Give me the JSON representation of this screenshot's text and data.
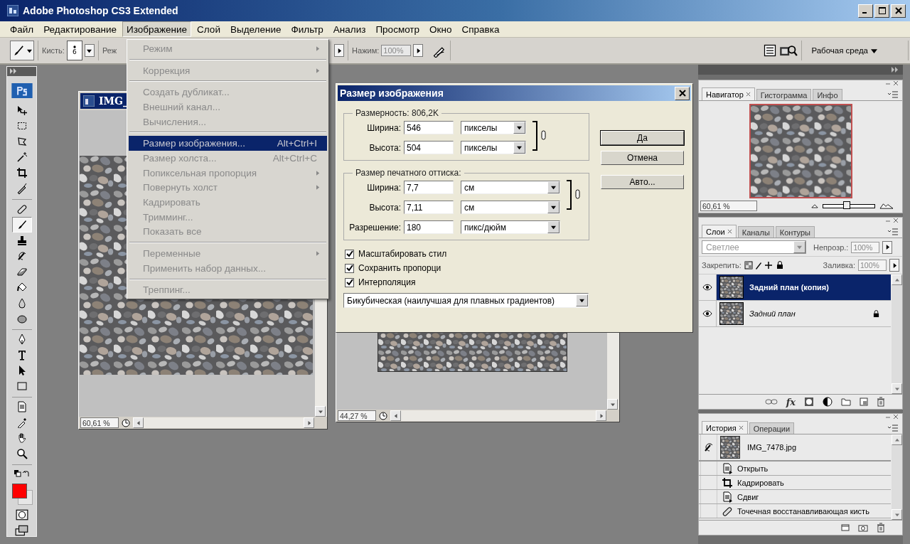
{
  "window": {
    "title": "Adobe Photoshop CS3 Extended"
  },
  "menu_bar": [
    {
      "label": "Файл",
      "selected": false
    },
    {
      "label": "Редактирование",
      "selected": false
    },
    {
      "label": "Изображение",
      "selected": true
    },
    {
      "label": "Слой",
      "selected": false
    },
    {
      "label": "Выделение",
      "selected": false
    },
    {
      "label": "Фильтр",
      "selected": false
    },
    {
      "label": "Анализ",
      "selected": false
    },
    {
      "label": "Просмотр",
      "selected": false
    },
    {
      "label": "Окно",
      "selected": false
    },
    {
      "label": "Справка",
      "selected": false
    }
  ],
  "options_bar": {
    "brush_label": "Кисть:",
    "brush_size": "6",
    "mode_label": "Реж",
    "pressure_label": "Нажим:",
    "pressure_value": "100%",
    "workspace": "Рабочая среда"
  },
  "tool_groups": [
    {
      "tools": [
        {
          "kind": "move",
          "selected": false
        },
        {
          "kind": "marquee",
          "selected": false
        },
        {
          "kind": "lasso",
          "selected": false
        },
        {
          "kind": "wand",
          "selected": false
        },
        {
          "kind": "crop",
          "selected": false
        },
        {
          "kind": "slice",
          "selected": false
        }
      ]
    },
    {
      "tools": [
        {
          "kind": "heal",
          "selected": false
        },
        {
          "kind": "brush",
          "selected": true
        },
        {
          "kind": "stamp",
          "selected": false
        },
        {
          "kind": "history",
          "selected": false
        },
        {
          "kind": "eraser",
          "selected": false
        },
        {
          "kind": "bucket",
          "selected": false
        },
        {
          "kind": "drop",
          "selected": false
        },
        {
          "kind": "sponge",
          "selected": false
        }
      ]
    },
    {
      "tools": [
        {
          "kind": "pen",
          "selected": false
        },
        {
          "kind": "type",
          "selected": false
        },
        {
          "kind": "select",
          "selected": false
        },
        {
          "kind": "rect",
          "selected": false
        }
      ]
    },
    {
      "tools": [
        {
          "kind": "note",
          "selected": false
        },
        {
          "kind": "eyedropper",
          "selected": false
        },
        {
          "kind": "hand",
          "selected": false
        },
        {
          "kind": "zoom",
          "selected": false
        }
      ]
    }
  ],
  "documents": [
    {
      "title": "IMG_",
      "zoom": "60,61 %"
    },
    {
      "zoom": "44,27 %"
    }
  ],
  "image_menu": {
    "groups": [
      {
        "items": [
          {
            "label": "Режим",
            "submenu": true,
            "disabled": true,
            "selected": false
          }
        ]
      },
      {
        "items": [
          {
            "label": "Коррекция",
            "submenu": true,
            "disabled": true,
            "selected": false
          }
        ]
      },
      {
        "items": [
          {
            "label": "Создать дубликат...",
            "submenu": false,
            "disabled": true,
            "selected": false
          },
          {
            "label": "Внешний канал...",
            "submenu": false,
            "disabled": true,
            "selected": false
          },
          {
            "label": "Вычисления...",
            "submenu": false,
            "disabled": true,
            "selected": false
          }
        ]
      },
      {
        "items": [
          {
            "label": "Размер изображения...",
            "shortcut": "Alt+Ctrl+I",
            "submenu": false,
            "disabled": true,
            "selected": true
          },
          {
            "label": "Размер холста...",
            "shortcut": "Alt+Ctrl+C",
            "submenu": false,
            "disabled": true,
            "selected": false
          },
          {
            "label": "Попиксельная пропорция",
            "submenu": true,
            "disabled": true,
            "selected": false
          },
          {
            "label": "Повернуть холст",
            "submenu": true,
            "disabled": true,
            "selected": false
          },
          {
            "label": "Кадрировать",
            "submenu": false,
            "disabled": true,
            "selected": false
          },
          {
            "label": "Тримминг...",
            "submenu": false,
            "disabled": true,
            "selected": false
          },
          {
            "label": "Показать все",
            "submenu": false,
            "disabled": true,
            "selected": false
          }
        ]
      },
      {
        "items": [
          {
            "label": "Переменные",
            "submenu": true,
            "disabled": true,
            "selected": false
          },
          {
            "label": "Применить набор данных...",
            "submenu": false,
            "disabled": true,
            "selected": false
          }
        ]
      },
      {
        "items": [
          {
            "label": "Треппинг...",
            "submenu": false,
            "disabled": true,
            "selected": false
          }
        ]
      }
    ]
  },
  "dialog": {
    "title": "Размер изображения",
    "pixel_dimensions": {
      "label": "Размерность:",
      "value": "806,2K",
      "fields": [
        {
          "label": "Ширина:",
          "value": "546",
          "unit": "пикселы"
        },
        {
          "label": "Высота:",
          "value": "504",
          "unit": "пикселы"
        }
      ]
    },
    "print_size": {
      "label": "Размер печатного оттиска:",
      "fields": [
        {
          "label": "Ширина:",
          "value": "7,7",
          "unit": "см"
        },
        {
          "label": "Высота:",
          "value": "7,11",
          "unit": "см"
        },
        {
          "label": "Разрешение:",
          "value": "180",
          "unit": "пикс/дюйм"
        }
      ]
    },
    "options": [
      {
        "label": "Масштабировать стил",
        "checked": true
      },
      {
        "label": "Сохранить пропорци",
        "checked": true
      },
      {
        "label": "Интерполяция",
        "checked": true
      }
    ],
    "resample_method": "Бикубическая (наилучшая для плавных градиентов)",
    "buttons": [
      {
        "label": "Да",
        "default": true
      },
      {
        "label": "Отмена",
        "default": false
      },
      {
        "label": "Авто...",
        "default": false
      }
    ]
  },
  "navigator": {
    "tabs": [
      {
        "label": "Навигатор",
        "selected": true
      },
      {
        "label": "Гистограмма",
        "selected": false
      },
      {
        "label": "Инфо",
        "selected": false
      }
    ],
    "zoom": "60,61 %",
    "zoom_slider": {
      "level": 0.45
    }
  },
  "layers": {
    "tabs": [
      {
        "label": "Слои",
        "selected": true
      },
      {
        "label": "Каналы",
        "selected": false
      },
      {
        "label": "Контуры",
        "selected": false
      }
    ],
    "blend_mode": "Светлее",
    "opacity_label": "Непрозр.:",
    "opacity": "100%",
    "lock_label": "Закрепить:",
    "fill_label": "Заливка:",
    "fill": "100%",
    "items": [
      {
        "name": "Задний план (копия)",
        "visible": true,
        "selected": true,
        "locked": false
      },
      {
        "name": "Задний план",
        "visible": true,
        "selected": false,
        "locked": true
      }
    ],
    "fx_label": "fx"
  },
  "history": {
    "tabs": [
      {
        "label": "История",
        "selected": true
      },
      {
        "label": "Операции",
        "selected": false
      }
    ],
    "snapshot": "IMG_7478.jpg",
    "steps": [
      {
        "label": "Открыть",
        "kind": "open"
      },
      {
        "label": "Кадрировать",
        "kind": "crop"
      },
      {
        "label": "Сдвиг",
        "kind": "open"
      },
      {
        "label": "Точечная восстанавливающая кисть",
        "kind": "heal"
      }
    ]
  }
}
